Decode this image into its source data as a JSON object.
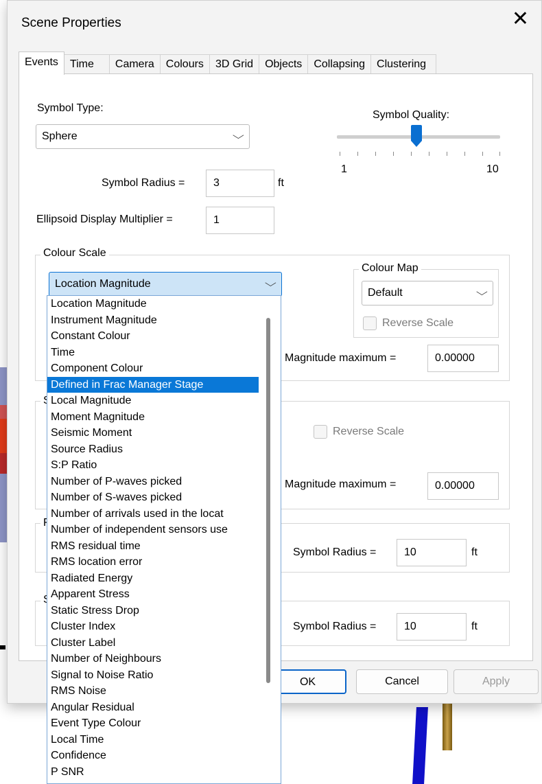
{
  "dialog": {
    "title": "Scene Properties"
  },
  "tabs": [
    {
      "label": "Events",
      "active": true
    },
    {
      "label": "Time"
    },
    {
      "label": "Camera"
    },
    {
      "label": "Colours"
    },
    {
      "label": "3D Grid"
    },
    {
      "label": "Objects"
    },
    {
      "label": "Collapsing"
    },
    {
      "label": "Clustering"
    }
  ],
  "symbol": {
    "type_label": "Symbol Type:",
    "type_value": "Sphere",
    "quality_label": "Symbol Quality:",
    "quality_min": "1",
    "quality_max": "10",
    "quality_value": 5,
    "radius_label": "Symbol Radius =",
    "radius_value": "3",
    "radius_unit": "ft",
    "ellipsoid_label": "Ellipsoid Display Multiplier =",
    "ellipsoid_value": "1"
  },
  "colour_scale": {
    "legend": "Colour Scale",
    "selected": "Location Magnitude",
    "colour_map_legend": "Colour Map",
    "colour_map_value": "Default",
    "reverse_label": "Reverse Scale",
    "mag_max_label": "Magnitude maximum =",
    "mag_max_value": "0.00000"
  },
  "size_scale": {
    "legend_fragment": "S",
    "reverse_label": "Reverse Scale",
    "mag_max_label": "Magnitude maximum =",
    "mag_max_value": "0.00000"
  },
  "group3": {
    "legend_fragment": "F",
    "radius_label": "Symbol Radius =",
    "radius_value": "10",
    "unit": "ft"
  },
  "group4": {
    "legend_fragment": "S",
    "radius_label": "Symbol Radius =",
    "radius_value": "10",
    "unit": "ft"
  },
  "dropdown_items": [
    "Location Magnitude",
    "Instrument Magnitude",
    "Constant Colour",
    "Time",
    "Component Colour",
    "Defined in Frac Manager Stage",
    "Local Magnitude",
    "Moment Magnitude",
    "Seismic Moment",
    "Source Radius",
    "S:P Ratio",
    "Number of P-waves picked",
    "Number of S-waves picked",
    "Number of arrivals used in the locat",
    "Number of independent sensors use",
    "RMS residual time",
    "RMS location error",
    "Radiated Energy",
    "Apparent Stress",
    "Static Stress Drop",
    "Cluster Index",
    "Cluster Label",
    "Number of Neighbours",
    "Signal to Noise Ratio",
    "RMS Noise",
    "Angular Residual",
    "Event Type Colour",
    "Local Time",
    "Confidence",
    "P SNR"
  ],
  "dropdown_highlighted_index": 5,
  "buttons": {
    "ok": "OK",
    "cancel": "Cancel",
    "apply": "Apply"
  },
  "colors": {
    "accent": "#0a78d7",
    "combo_open_bg": "#cde4f7"
  }
}
